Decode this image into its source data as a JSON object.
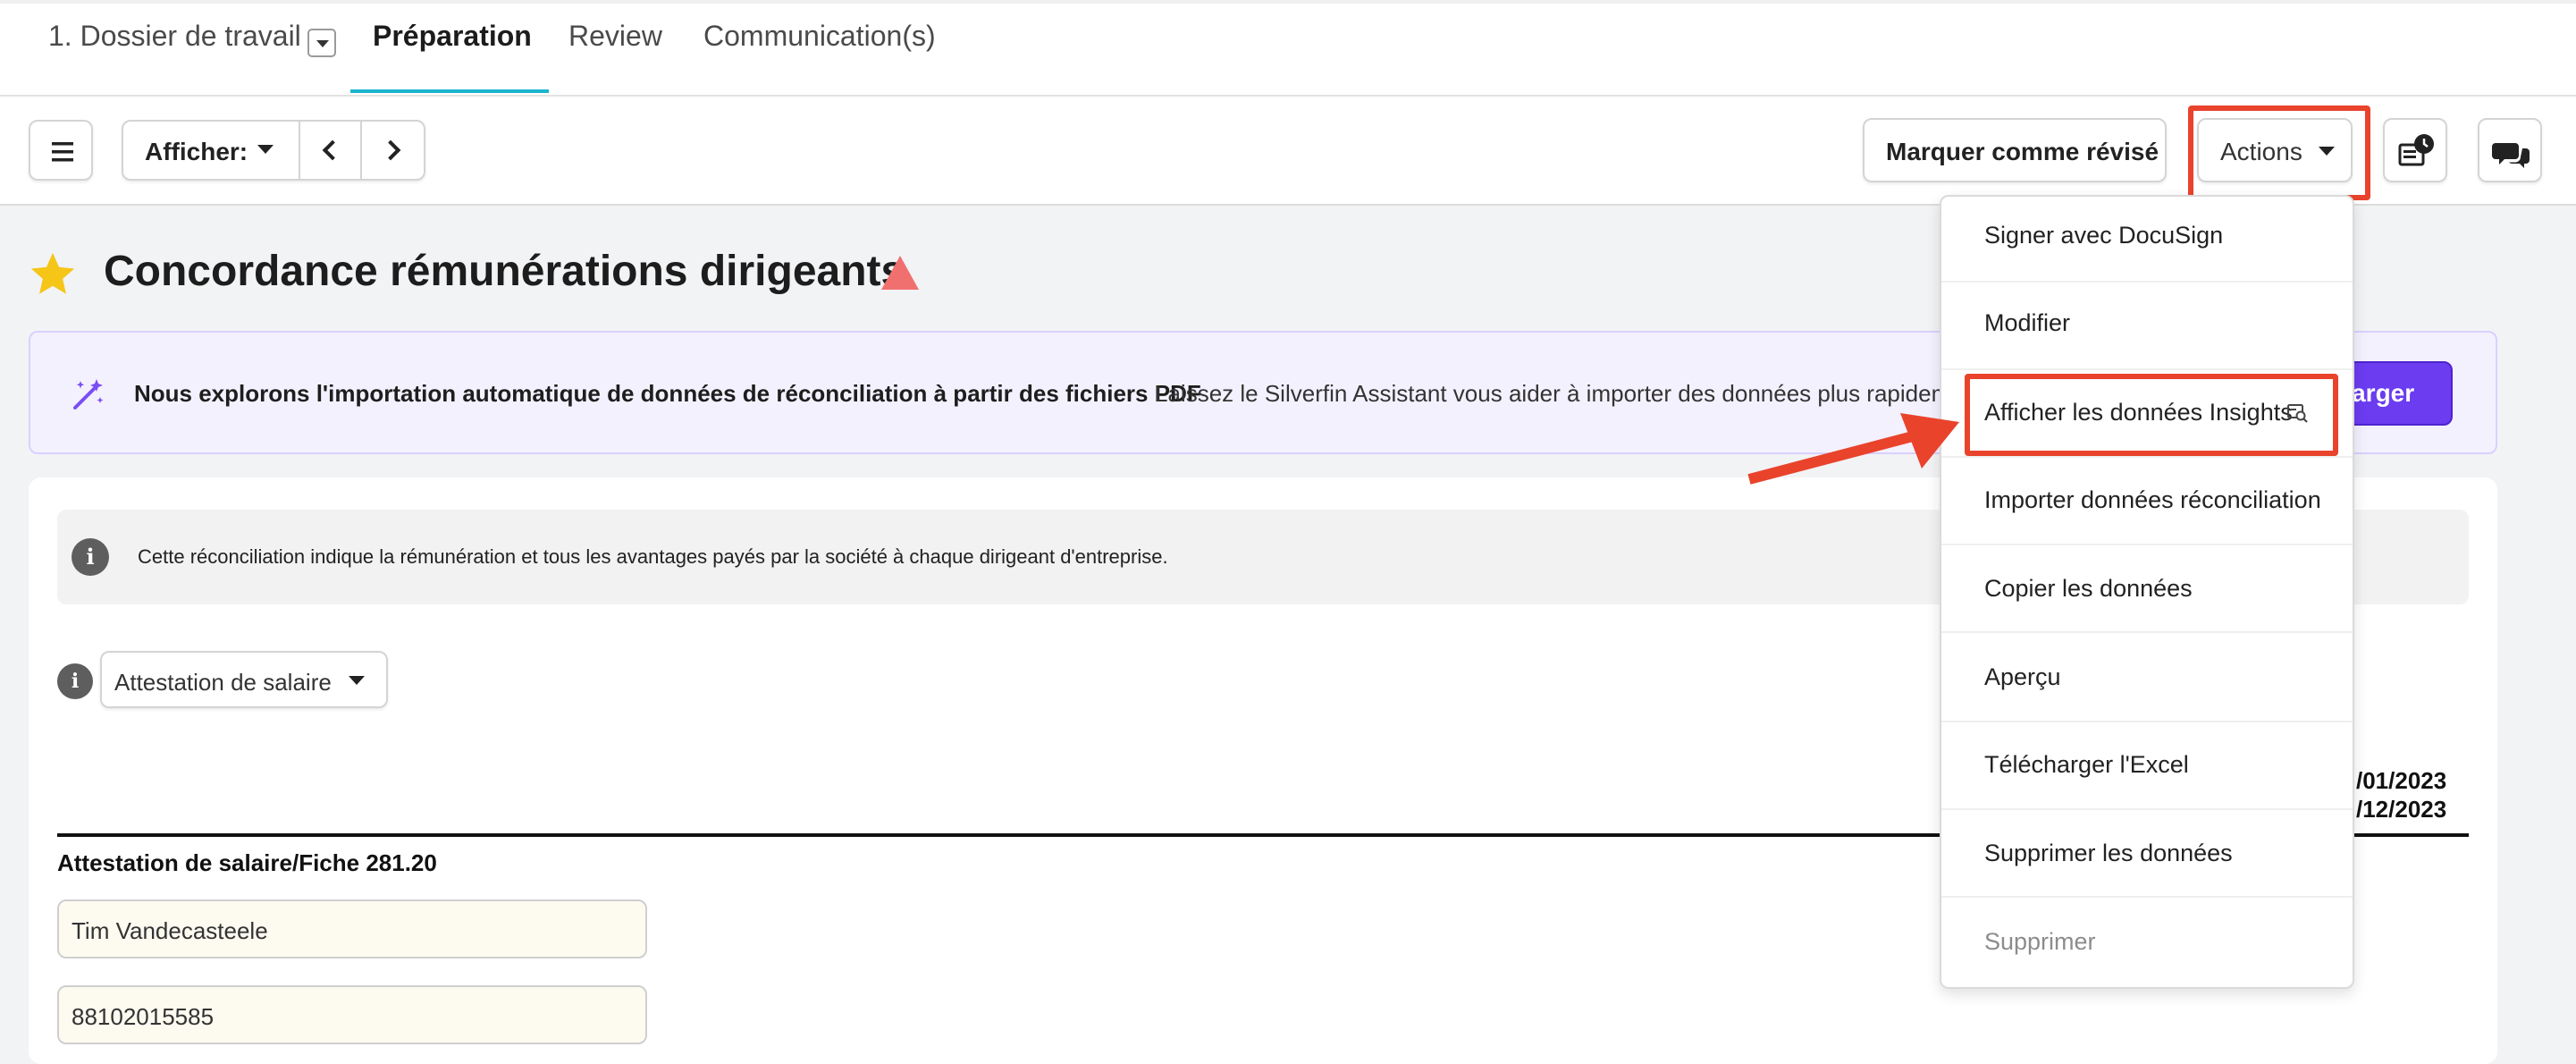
{
  "tabs": {
    "workfile": "1. Dossier de travail",
    "preparation": "Préparation",
    "review": "Review",
    "communication": "Communication(s)"
  },
  "toolbar": {
    "menu_icon": "hamburger-icon",
    "show_label": "Afficher:",
    "mark_reviewed": "Marquer comme révisé",
    "actions": "Actions",
    "history_icon": "document-clock-icon",
    "comments_icon": "chat-bubbles-icon"
  },
  "page": {
    "title": "Concordance rémunérations dirigeants",
    "favorite_icon": "star-icon",
    "warning_icon": "warning-triangle-icon"
  },
  "banner": {
    "icon": "magic-wand-icon",
    "heading": "Nous explorons l'importation automatique de données de réconciliation à partir des fichiers PDF",
    "text": "Laissez le Silverfin Assistant vous aider à importer des données plus rapidement",
    "button_visible_text": "harger"
  },
  "info": {
    "text": "Cette réconciliation indique la rémunération et tous les avantages payés par la société à chaque dirigeant d'entreprise."
  },
  "form": {
    "document_type": "Attestation de salaire",
    "date_start": "/01/2023",
    "date_end": "/12/2023",
    "section_label": "Attestation de salaire/Fiche 281.20",
    "name_value": "Tim Vandecasteele",
    "number_value": "88102015585"
  },
  "actions_menu": {
    "items": [
      {
        "label": "Signer avec DocuSign"
      },
      {
        "label": "Modifier"
      },
      {
        "label": "Afficher les données Insights",
        "icon": "insights-search-icon"
      },
      {
        "label": "Importer données réconciliation"
      },
      {
        "label": "Copier les données"
      },
      {
        "label": "Aperçu"
      },
      {
        "label": "Télécharger l'Excel"
      },
      {
        "label": "Supprimer les données"
      },
      {
        "label": "Supprimer",
        "disabled": true
      }
    ]
  },
  "colors": {
    "annotation": "#e9432c",
    "tab_accent": "#1bb5d0",
    "primary_button": "#6b3cf0",
    "star": "#f5c518",
    "warning": "#f07070"
  }
}
